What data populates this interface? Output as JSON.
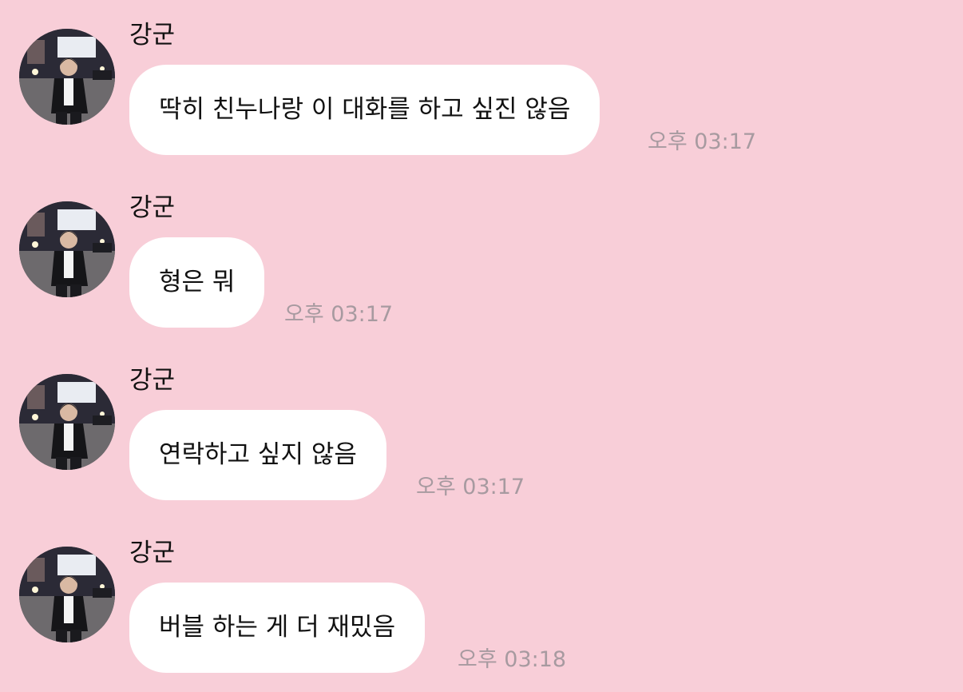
{
  "theme": {
    "background": "#f8ced8",
    "bubble": "#ffffff",
    "text": "#111111",
    "timestamp": "#a79aa0"
  },
  "messages": [
    {
      "sender": "강군",
      "avatar_icon": "profile-photo-avatar",
      "text": "딱히 친누나랑 이 대화를 하고 싶진 않음",
      "time": "오후 03:17"
    },
    {
      "sender": "강군",
      "avatar_icon": "profile-photo-avatar",
      "text": "형은 뭐",
      "time": "오후 03:17"
    },
    {
      "sender": "강군",
      "avatar_icon": "profile-photo-avatar",
      "text": "연락하고 싶지 않음",
      "time": "오후 03:17"
    },
    {
      "sender": "강군",
      "avatar_icon": "profile-photo-avatar",
      "text": "버블 하는 게 더 재밌음",
      "time": "오후 03:18"
    }
  ]
}
